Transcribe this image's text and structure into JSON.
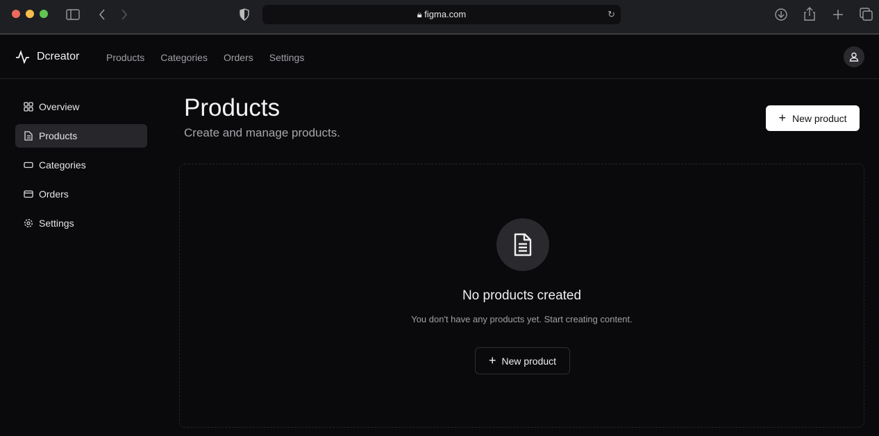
{
  "browser": {
    "url": "figma.com"
  },
  "app": {
    "brand": "Dcreator",
    "nav": [
      "Products",
      "Categories",
      "Orders",
      "Settings"
    ]
  },
  "sidebar": {
    "items": [
      {
        "label": "Overview",
        "icon": "grid-icon"
      },
      {
        "label": "Products",
        "icon": "file-icon",
        "active": true
      },
      {
        "label": "Categories",
        "icon": "tag-icon"
      },
      {
        "label": "Orders",
        "icon": "credit-card-icon"
      },
      {
        "label": "Settings",
        "icon": "gear-icon"
      }
    ]
  },
  "main": {
    "title": "Products",
    "subtitle": "Create and manage products.",
    "new_button": "New product",
    "empty": {
      "title": "No products created",
      "text": "You don't have any products yet. Start creating content.",
      "button": "New product"
    }
  }
}
